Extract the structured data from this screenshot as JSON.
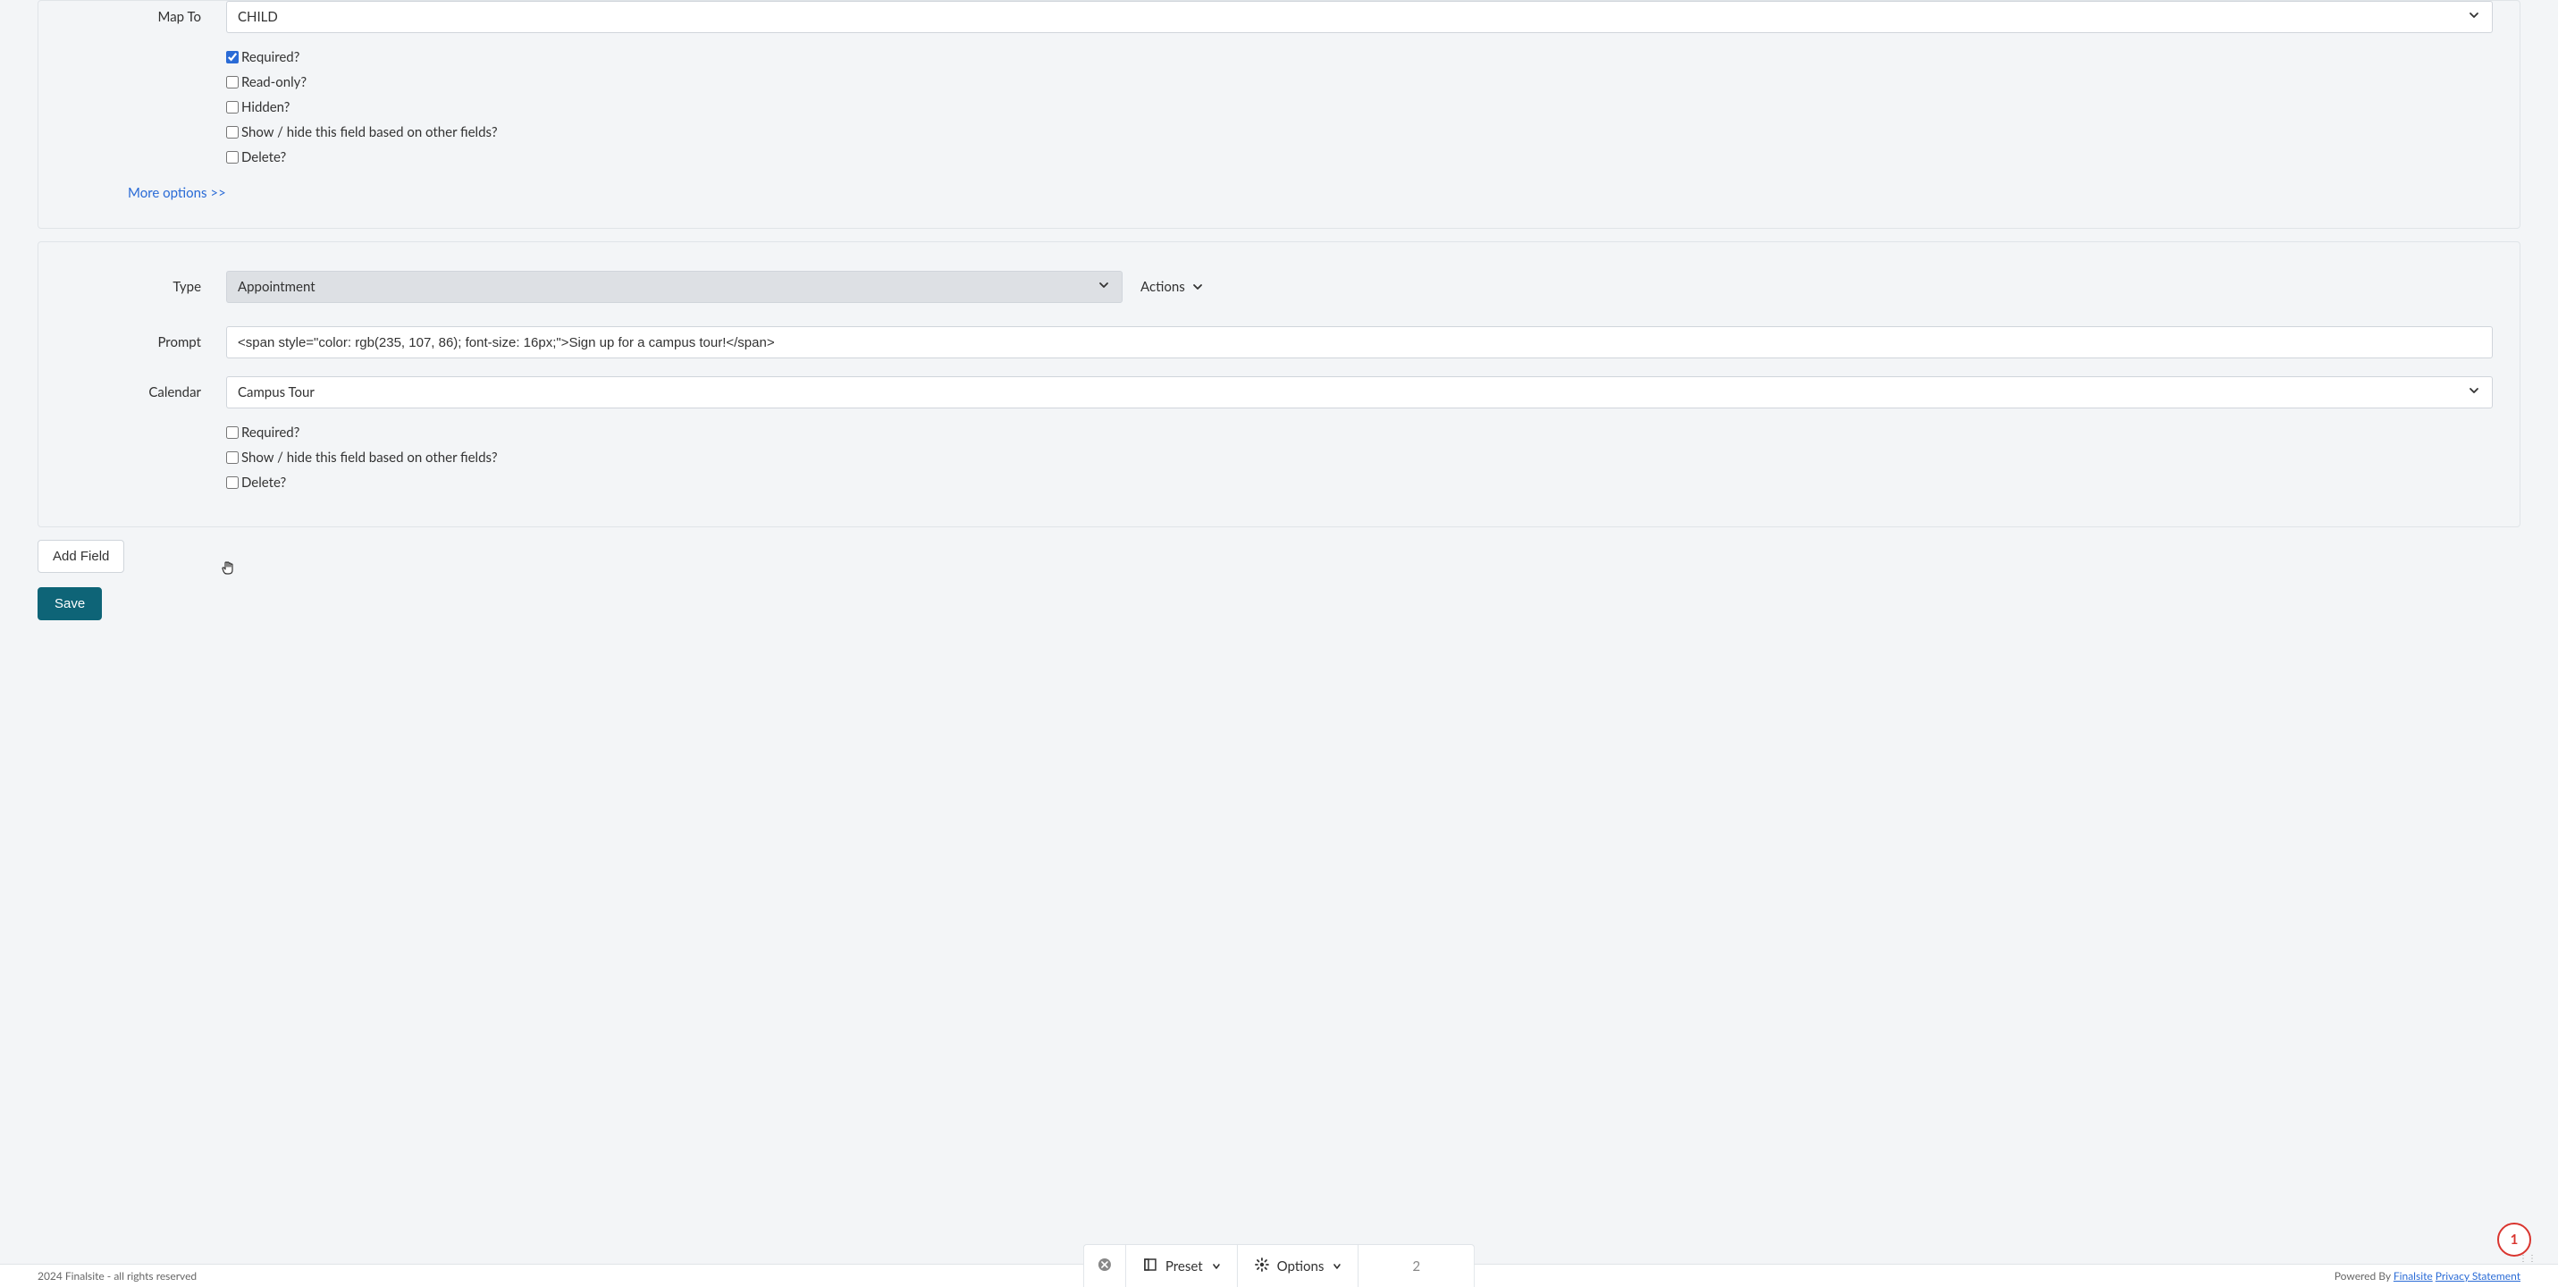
{
  "card1": {
    "map_to_label": "Map To",
    "map_to_value": "CHILD",
    "checkboxes": {
      "required": {
        "label": "Required?",
        "checked": true
      },
      "read_only": {
        "label": "Read-only?",
        "checked": false
      },
      "hidden": {
        "label": "Hidden?",
        "checked": false
      },
      "show_hide": {
        "label": "Show / hide this field based on other fields?",
        "checked": false
      },
      "delete": {
        "label": "Delete?",
        "checked": false
      }
    },
    "more_options": "More options >>"
  },
  "card2": {
    "type_label": "Type",
    "type_value": "Appointment",
    "actions_label": "Actions",
    "prompt_label": "Prompt",
    "prompt_value": "<span style=\"color: rgb(235, 107, 86); font-size: 16px;\">Sign up for a campus tour!</span>",
    "calendar_label": "Calendar",
    "calendar_value": "Campus Tour",
    "checkboxes": {
      "required": {
        "label": "Required?",
        "checked": false
      },
      "show_hide": {
        "label": "Show / hide this field based on other fields?",
        "checked": false
      },
      "delete": {
        "label": "Delete?",
        "checked": false
      }
    }
  },
  "buttons": {
    "add_field": "Add Field",
    "save": "Save"
  },
  "footer": {
    "left": "2024 Finalsite - all rights reserved",
    "powered_by": "Powered By ",
    "finalsite": "Finalsite",
    "privacy": "Privacy Statement"
  },
  "toolbar": {
    "preset": "Preset",
    "options": "Options",
    "page": "2"
  },
  "badge": {
    "count": "1"
  }
}
